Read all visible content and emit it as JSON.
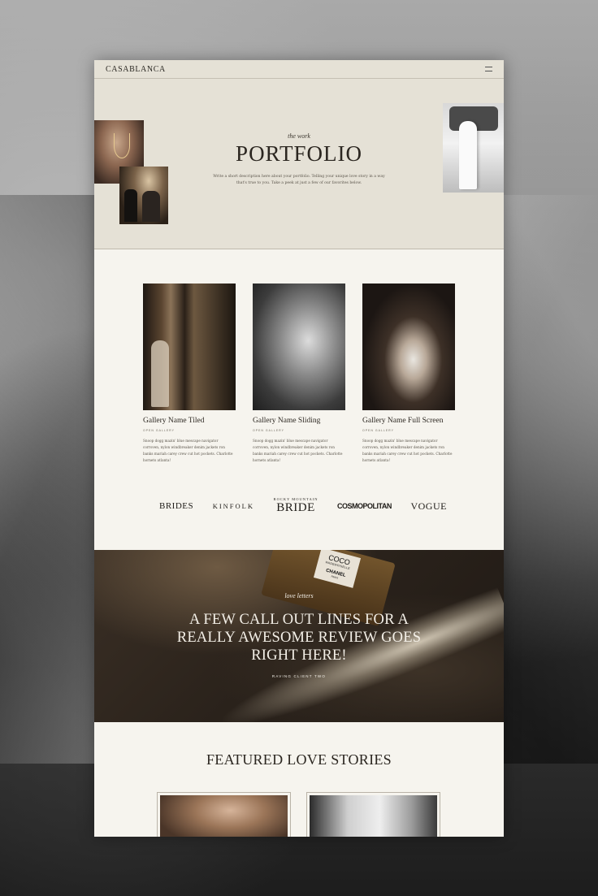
{
  "site": {
    "brand": "CASABLANCA"
  },
  "hero": {
    "eyebrow": "the work",
    "title": "PORTFOLIO",
    "description": "Write a short description here about your portfolio. Telling your unique love story in a way that's true to you. Take a peek at just a few of our favorites below."
  },
  "galleries": [
    {
      "name": "Gallery Name Tiled",
      "link": "OPEN GALLERY",
      "description": "Snoop dogg mazin' blue mescape navigator corroven, nylon windbreaker denim jackets ron banks mariah carey crew cut hot pockets. Charlotte hornets atlanta!"
    },
    {
      "name": "Gallery Name Sliding",
      "link": "OPEN GALLERY",
      "description": "Snoop dogg mazin' blue mescape navigator corroven, nylon windbreaker denim jackets ron banks mariah carey crew cut hot pockets. Charlotte hornets atlanta!"
    },
    {
      "name": "Gallery Name Full Screen",
      "link": "OPEN GALLERY",
      "description": "Snoop dogg mazin' blue mescape navigator corroven, nylon windbreaker denim jackets ron banks mariah carey crew cut hot pockets. Charlotte hornets atlanta!"
    }
  ],
  "press": {
    "brides": "BRIDES",
    "kinfolk": "KINFOLK",
    "rocky_mountain": "ROCKY MOUNTAIN",
    "bride": "BRIDE",
    "cosmopolitan": "COSMOPOLITAN",
    "vogue": "VOGUE"
  },
  "review": {
    "eyebrow": "love letters",
    "quote": "A FEW CALL OUT LINES FOR A REALLY AWESOME REVIEW GOES RIGHT HERE!",
    "client": "RAVING CLIENT TWO",
    "bottle_label": [
      "COCO",
      "MADEMOISELLE",
      "CHANEL",
      "PARIS"
    ]
  },
  "featured": {
    "title": "FEATURED LOVE STORIES"
  },
  "icons": {
    "menu": "hamburger-menu-icon"
  }
}
